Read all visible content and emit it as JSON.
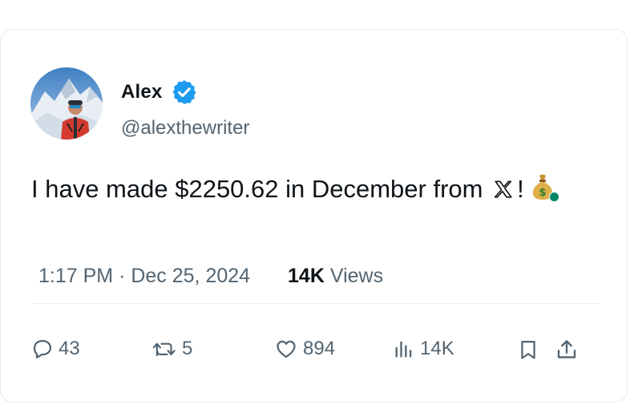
{
  "author": {
    "name": "Alex",
    "handle": "@alexthewriter",
    "verified": true,
    "verified_color": "#1d9bf0",
    "avatar": "avatar-mountain-climber"
  },
  "tweet": {
    "text_before": "I have made $2250.62 in December from ",
    "text_after": "!",
    "inline_icons": [
      "x-logo-icon",
      "money-bag-icon"
    ]
  },
  "meta": {
    "time": "1:17 PM",
    "separator": "·",
    "date": "Dec 25, 2024",
    "views_count": "14K",
    "views_label": "Views"
  },
  "actions": {
    "replies": "43",
    "retweets": "5",
    "likes": "894",
    "views": "14K"
  },
  "colors": {
    "text": "#0f1419",
    "secondary": "#536471",
    "border": "#e6e9ec"
  }
}
